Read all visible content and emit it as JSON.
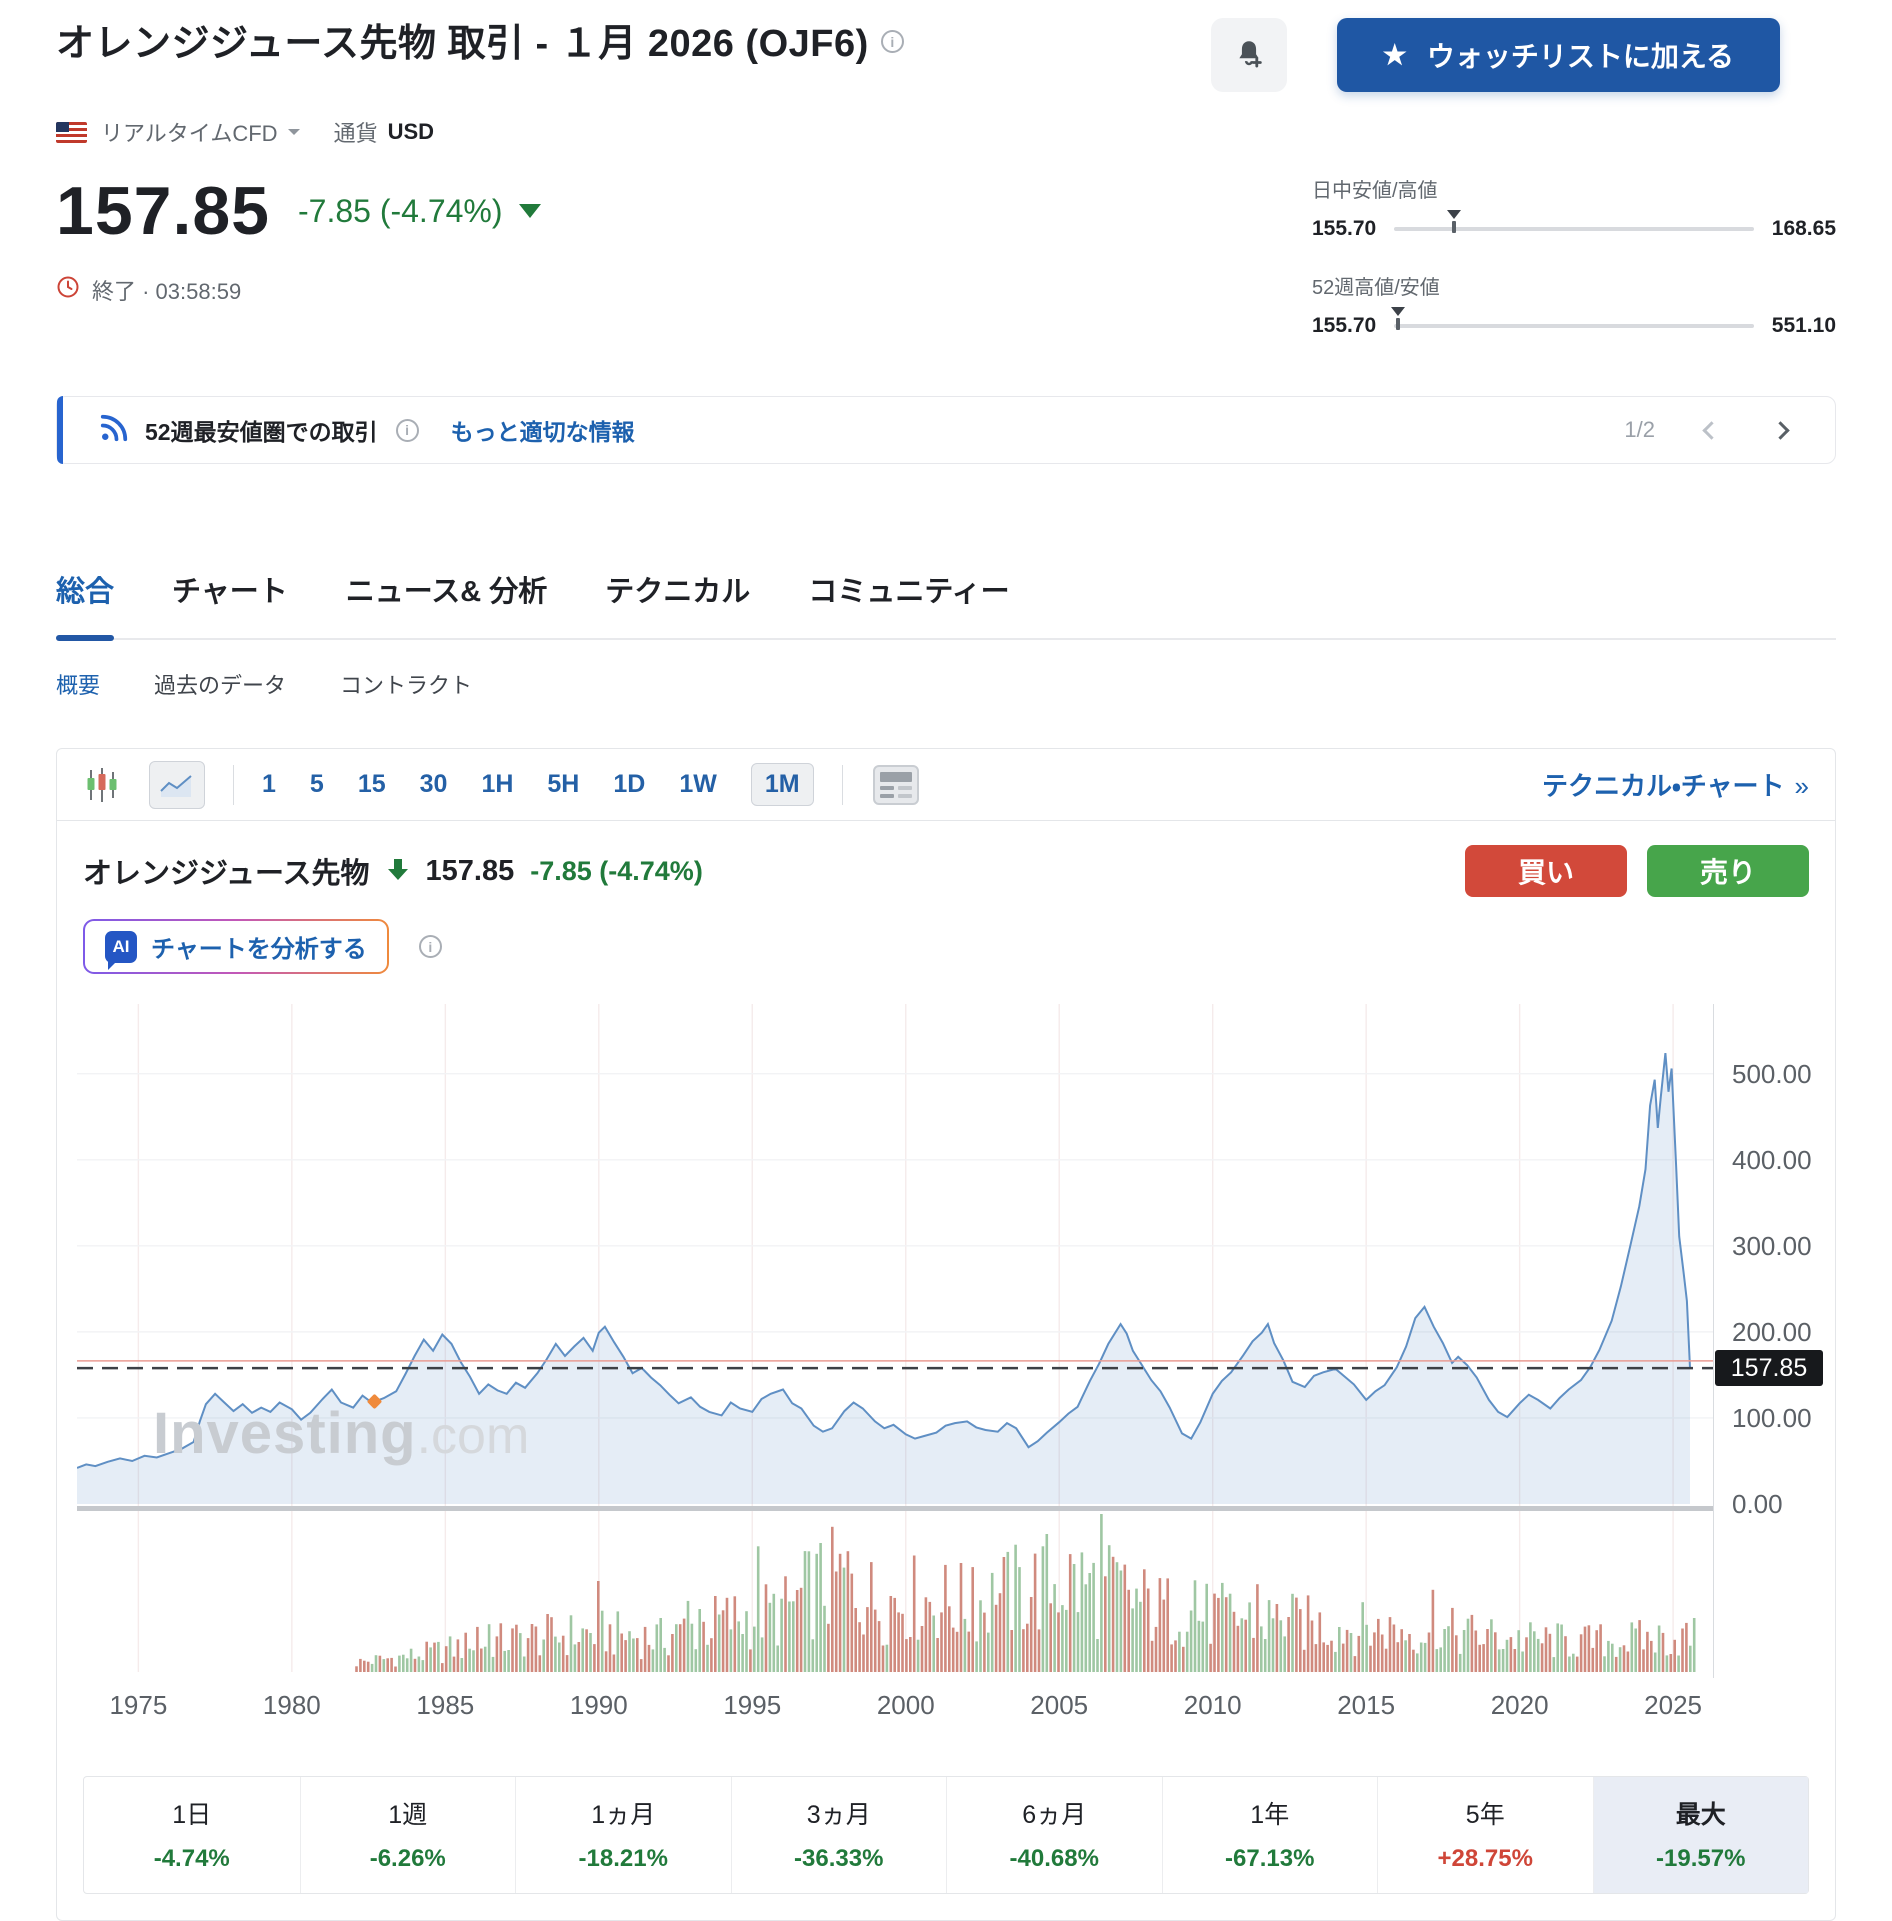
{
  "header": {
    "title": "オレンジジュース先物 取引 - １月 2026 (OJF6)",
    "market_type_label": "リアルタイムCFD",
    "currency_label": "通貨",
    "currency": "USD",
    "watchlist_button": "ウォッチリストに加える",
    "price": "157.85",
    "change": "-7.85 (-4.74%)",
    "status": "終了 · 03:58:59",
    "ranges": [
      {
        "label": "日中安値/高値",
        "low": "155.70",
        "high": "168.65",
        "marker_pct": 16.6
      },
      {
        "label": "52週高値/安値",
        "low": "155.70",
        "high": "551.10",
        "marker_pct": 1.0
      }
    ]
  },
  "notice": {
    "text": "52週最安値圏での取引",
    "link": "もっと適切な情報",
    "page": "1/2"
  },
  "tabs": [
    {
      "id": "overview",
      "label": "総合",
      "active": true
    },
    {
      "id": "chart",
      "label": "チャート"
    },
    {
      "id": "news-analysis",
      "label": "ニュース& 分析"
    },
    {
      "id": "technical",
      "label": "テクニカル"
    },
    {
      "id": "community",
      "label": "コミュニティー"
    }
  ],
  "subtabs": [
    {
      "id": "summary",
      "label": "概要",
      "active": true
    },
    {
      "id": "history",
      "label": "過去のデータ"
    },
    {
      "id": "contracts",
      "label": "コントラクト"
    }
  ],
  "toolbar": {
    "intervals": [
      {
        "label": "1"
      },
      {
        "label": "5"
      },
      {
        "label": "15"
      },
      {
        "label": "30"
      },
      {
        "label": "1H"
      },
      {
        "label": "5H"
      },
      {
        "label": "1D"
      },
      {
        "label": "1W"
      },
      {
        "label": "1M",
        "active": true
      }
    ],
    "tech_link": "テクニカル・チャート",
    "tech_link_arrow": "»"
  },
  "chart_header": {
    "name": "オレンジジュース先物",
    "price": "157.85",
    "change": "-7.85 (-4.74%)",
    "ai_button": "チャートを分析する",
    "buy": "買い",
    "sell": "売り"
  },
  "watermark": {
    "main": "Investing",
    "suffix": ".com"
  },
  "chart_data": {
    "type": "area",
    "title": "オレンジジュース先物 月足 (1M)",
    "x_range": [
      1973,
      2026.3
    ],
    "y_range": [
      0,
      581
    ],
    "x_ticks": [
      1975,
      1980,
      1985,
      1990,
      1995,
      2000,
      2005,
      2010,
      2015,
      2020,
      2025
    ],
    "y_ticks": [
      {
        "v": 500,
        "label": "500.00"
      },
      {
        "v": 400,
        "label": "400.00"
      },
      {
        "v": 300,
        "label": "300.00"
      },
      {
        "v": 200,
        "label": "200.00"
      },
      {
        "v": 100,
        "label": "100.00"
      },
      {
        "v": 0,
        "label": "0.00"
      }
    ],
    "last_price": 157.85,
    "last_price_label": "157.85",
    "red_line_value": 166.3,
    "series": [
      [
        1973,
        42
      ],
      [
        1973.3,
        46
      ],
      [
        1973.6,
        44
      ],
      [
        1974,
        49
      ],
      [
        1974.4,
        53
      ],
      [
        1974.8,
        50
      ],
      [
        1975.2,
        56
      ],
      [
        1975.6,
        54
      ],
      [
        1976,
        59
      ],
      [
        1976.4,
        64
      ],
      [
        1976.8,
        72
      ],
      [
        1977,
        96
      ],
      [
        1977.2,
        116
      ],
      [
        1977.5,
        128
      ],
      [
        1977.8,
        118
      ],
      [
        1978.1,
        108
      ],
      [
        1978.4,
        116
      ],
      [
        1978.7,
        106
      ],
      [
        1979,
        112
      ],
      [
        1979.3,
        107
      ],
      [
        1979.6,
        118
      ],
      [
        1980,
        110
      ],
      [
        1980.3,
        98
      ],
      [
        1980.6,
        106
      ],
      [
        1981,
        122
      ],
      [
        1981.3,
        133
      ],
      [
        1981.6,
        118
      ],
      [
        1982,
        112
      ],
      [
        1982.3,
        126
      ],
      [
        1982.6,
        118
      ],
      [
        1983,
        123
      ],
      [
        1983.4,
        131
      ],
      [
        1983.7,
        151
      ],
      [
        1984,
        172
      ],
      [
        1984.3,
        191
      ],
      [
        1984.6,
        178
      ],
      [
        1984.9,
        197
      ],
      [
        1985.2,
        186
      ],
      [
        1985.5,
        165
      ],
      [
        1985.8,
        148
      ],
      [
        1986.1,
        128
      ],
      [
        1986.4,
        139
      ],
      [
        1986.7,
        132
      ],
      [
        1987,
        128
      ],
      [
        1987.3,
        141
      ],
      [
        1987.6,
        135
      ],
      [
        1988,
        152
      ],
      [
        1988.3,
        168
      ],
      [
        1988.6,
        186
      ],
      [
        1988.9,
        172
      ],
      [
        1989.2,
        183
      ],
      [
        1989.5,
        193
      ],
      [
        1989.8,
        178
      ],
      [
        1990,
        199
      ],
      [
        1990.2,
        206
      ],
      [
        1990.5,
        188
      ],
      [
        1990.8,
        171
      ],
      [
        1991.1,
        152
      ],
      [
        1991.4,
        158
      ],
      [
        1991.7,
        147
      ],
      [
        1992,
        138
      ],
      [
        1992.3,
        127
      ],
      [
        1992.6,
        117
      ],
      [
        1993,
        124
      ],
      [
        1993.3,
        113
      ],
      [
        1993.6,
        107
      ],
      [
        1994,
        103
      ],
      [
        1994.3,
        118
      ],
      [
        1994.6,
        111
      ],
      [
        1995,
        107
      ],
      [
        1995.3,
        122
      ],
      [
        1995.6,
        128
      ],
      [
        1996,
        133
      ],
      [
        1996.3,
        117
      ],
      [
        1996.6,
        111
      ],
      [
        1997,
        91
      ],
      [
        1997.3,
        84
      ],
      [
        1997.6,
        88
      ],
      [
        1998,
        108
      ],
      [
        1998.3,
        118
      ],
      [
        1998.6,
        111
      ],
      [
        1999,
        96
      ],
      [
        1999.3,
        88
      ],
      [
        1999.6,
        92
      ],
      [
        2000,
        81
      ],
      [
        2000.3,
        76
      ],
      [
        2000.6,
        79
      ],
      [
        2001,
        83
      ],
      [
        2001.3,
        91
      ],
      [
        2001.6,
        94
      ],
      [
        2002,
        96
      ],
      [
        2002.3,
        89
      ],
      [
        2002.6,
        86
      ],
      [
        2003,
        84
      ],
      [
        2003.3,
        94
      ],
      [
        2003.6,
        88
      ],
      [
        2004,
        66
      ],
      [
        2004.3,
        73
      ],
      [
        2004.6,
        83
      ],
      [
        2005,
        95
      ],
      [
        2005.3,
        105
      ],
      [
        2005.6,
        113
      ],
      [
        2006,
        143
      ],
      [
        2006.3,
        163
      ],
      [
        2006.6,
        186
      ],
      [
        2007,
        209
      ],
      [
        2007.2,
        198
      ],
      [
        2007.4,
        178
      ],
      [
        2007.7,
        161
      ],
      [
        2008,
        144
      ],
      [
        2008.3,
        131
      ],
      [
        2008.6,
        112
      ],
      [
        2009,
        82
      ],
      [
        2009.3,
        76
      ],
      [
        2009.6,
        95
      ],
      [
        2010,
        128
      ],
      [
        2010.3,
        143
      ],
      [
        2010.6,
        153
      ],
      [
        2011,
        173
      ],
      [
        2011.3,
        189
      ],
      [
        2011.6,
        199
      ],
      [
        2011.8,
        209
      ],
      [
        2012,
        187
      ],
      [
        2012.3,
        167
      ],
      [
        2012.6,
        142
      ],
      [
        2013,
        136
      ],
      [
        2013.3,
        149
      ],
      [
        2013.6,
        153
      ],
      [
        2014,
        157
      ],
      [
        2014.3,
        148
      ],
      [
        2014.6,
        139
      ],
      [
        2015,
        121
      ],
      [
        2015.3,
        131
      ],
      [
        2015.6,
        138
      ],
      [
        2016,
        159
      ],
      [
        2016.3,
        183
      ],
      [
        2016.6,
        216
      ],
      [
        2016.9,
        229
      ],
      [
        2017.2,
        206
      ],
      [
        2017.5,
        187
      ],
      [
        2017.8,
        164
      ],
      [
        2018,
        171
      ],
      [
        2018.3,
        161
      ],
      [
        2018.6,
        147
      ],
      [
        2019,
        121
      ],
      [
        2019.3,
        107
      ],
      [
        2019.6,
        101
      ],
      [
        2020,
        117
      ],
      [
        2020.3,
        127
      ],
      [
        2020.6,
        121
      ],
      [
        2021,
        111
      ],
      [
        2021.3,
        123
      ],
      [
        2021.6,
        133
      ],
      [
        2022,
        144
      ],
      [
        2022.3,
        159
      ],
      [
        2022.6,
        179
      ],
      [
        2023,
        213
      ],
      [
        2023.3,
        253
      ],
      [
        2023.6,
        299
      ],
      [
        2023.9,
        346
      ],
      [
        2024.1,
        389
      ],
      [
        2024.25,
        463
      ],
      [
        2024.4,
        493
      ],
      [
        2024.5,
        437
      ],
      [
        2024.6,
        473
      ],
      [
        2024.75,
        524
      ],
      [
        2024.85,
        479
      ],
      [
        2024.95,
        506
      ],
      [
        2025.1,
        391
      ],
      [
        2025.2,
        311
      ],
      [
        2025.35,
        267
      ],
      [
        2025.45,
        236
      ],
      [
        2025.55,
        158
      ]
    ],
    "volume_envelope": [
      [
        1982,
        0.1
      ],
      [
        1984,
        0.18
      ],
      [
        1986,
        0.3
      ],
      [
        1988,
        0.38
      ],
      [
        1990,
        0.42
      ],
      [
        1992,
        0.36
      ],
      [
        1994,
        0.55
      ],
      [
        1996,
        0.65
      ],
      [
        1997,
        0.9
      ],
      [
        1998,
        1.0
      ],
      [
        1999,
        0.75
      ],
      [
        2000,
        0.8
      ],
      [
        2002,
        0.72
      ],
      [
        2004,
        0.9
      ],
      [
        2005,
        1.0
      ],
      [
        2006,
        0.92
      ],
      [
        2007,
        0.85
      ],
      [
        2008,
        0.68
      ],
      [
        2010,
        0.6
      ],
      [
        2012,
        0.55
      ],
      [
        2014,
        0.48
      ],
      [
        2016,
        0.45
      ],
      [
        2018,
        0.42
      ],
      [
        2020,
        0.35
      ],
      [
        2022,
        0.32
      ],
      [
        2024,
        0.35
      ],
      [
        2025.7,
        0.38
      ]
    ],
    "legend": "none",
    "grid": true
  },
  "performance": [
    {
      "id": "1d",
      "label": "1日",
      "value": "-4.74%",
      "dir": "down"
    },
    {
      "id": "1w",
      "label": "1週",
      "value": "-6.26%",
      "dir": "down"
    },
    {
      "id": "1m",
      "label": "1ヵ月",
      "value": "-18.21%",
      "dir": "down"
    },
    {
      "id": "3m",
      "label": "3ヵ月",
      "value": "-36.33%",
      "dir": "down"
    },
    {
      "id": "6m",
      "label": "6ヵ月",
      "value": "-40.68%",
      "dir": "down"
    },
    {
      "id": "1y",
      "label": "1年",
      "value": "-67.13%",
      "dir": "down"
    },
    {
      "id": "5y",
      "label": "5年",
      "value": "+28.75%",
      "dir": "up"
    },
    {
      "id": "max",
      "label": "最大",
      "value": "-19.57%",
      "dir": "down",
      "active": true
    }
  ],
  "colors": {
    "down_green": "#217a3b",
    "up_red": "#cf4638",
    "buy_red": "#d2493a",
    "sell_green": "#47a54b",
    "link_blue": "#1d61ae",
    "brand_blue": "#1f57a4",
    "line_blue": "#5f8fc4",
    "badge_black": "#17191c",
    "accent_blue": "#2764cf"
  }
}
